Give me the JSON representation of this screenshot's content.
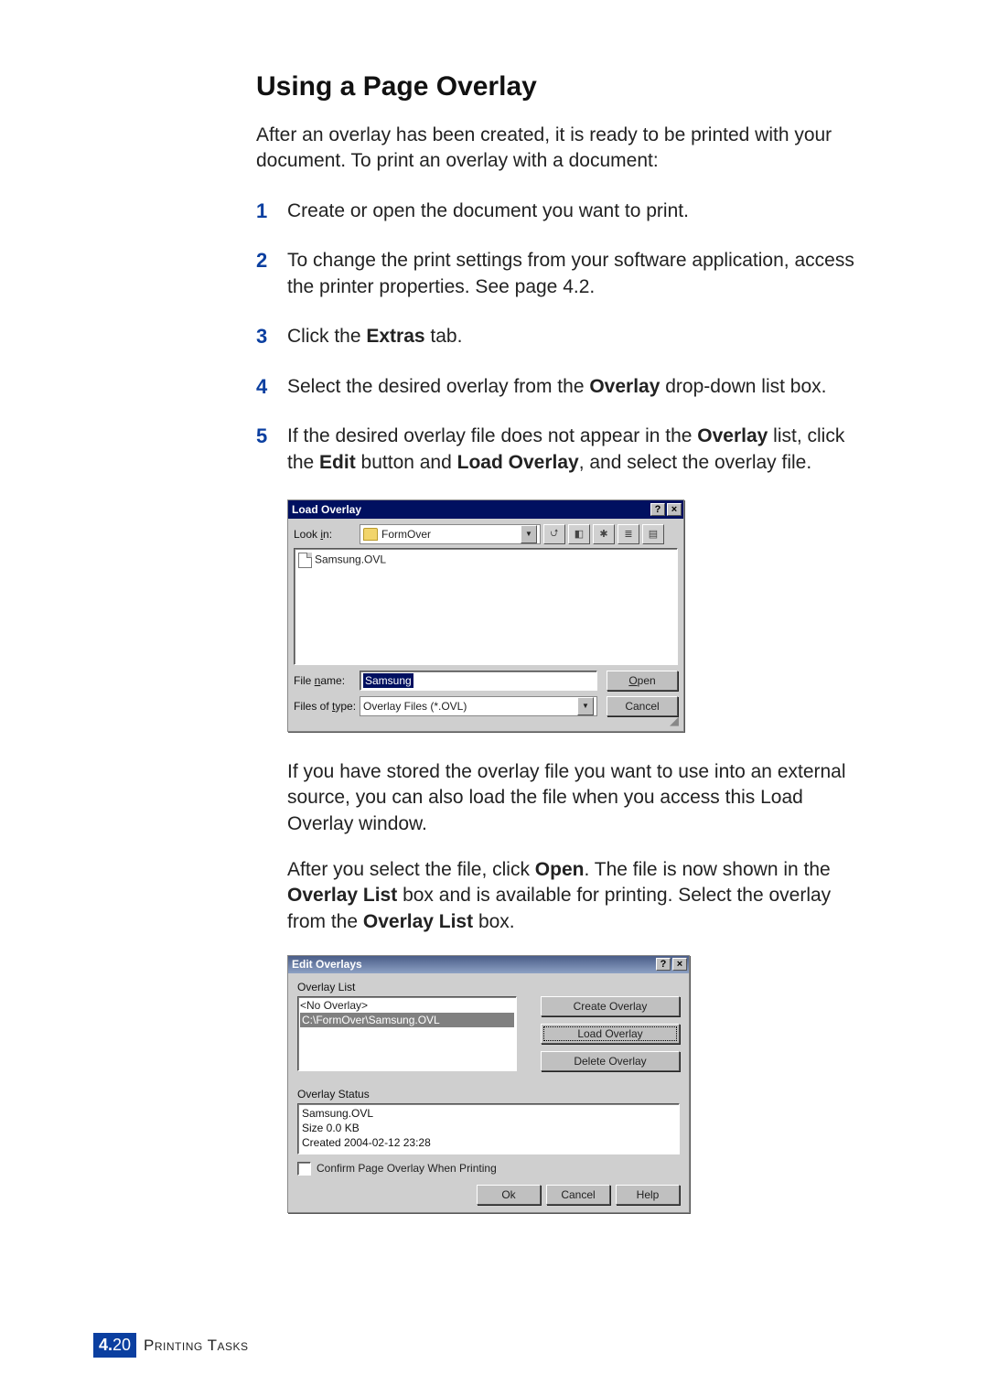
{
  "title": "Using a Page Overlay",
  "intro": "After an overlay has been created, it is ready to be printed with your document. To print an overlay with a document:",
  "steps": {
    "s1": {
      "num": "1",
      "text": "Create or open the document you want to print."
    },
    "s2": {
      "num": "2",
      "before": "To change the print settings from your software application, access the printer properties. See ",
      "link": "page 4.2",
      "after": "."
    },
    "s3": {
      "num": "3",
      "before": "Click the ",
      "bold": "Extras",
      "after": " tab."
    },
    "s4": {
      "num": "4",
      "before": "Select the desired overlay from the ",
      "bold": "Overlay",
      "after": " drop-down list box."
    },
    "s5": {
      "num": "5",
      "seg1": "If the desired overlay file does not appear in the ",
      "b1": "Overlay",
      "seg2": " list, click the ",
      "b2": "Edit",
      "seg3": " button and ",
      "b3": "Load Overlay",
      "seg4": ", and select the overlay file."
    }
  },
  "load_dialog": {
    "title": "Load Overlay",
    "help_btn": "?",
    "close_btn": "×",
    "look_in_lbl": {
      "pre": "Look ",
      "u": "i",
      "post": "n:"
    },
    "look_in_value": "FormOver",
    "icons": {
      "up": "folder-up-icon",
      "desktop": "desktop-icon",
      "newfolder": "new-folder-icon",
      "list": "list-view-icon",
      "details": "details-view-icon"
    },
    "file_item": "Samsung.OVL",
    "filename_lbl": {
      "pre": "File ",
      "u": "n",
      "post": "ame:"
    },
    "filename_value": "Samsung",
    "filetype_lbl": {
      "pre": "Files of ",
      "u": "t",
      "post": "ype:"
    },
    "filetype_value": "Overlay Files (*.OVL)",
    "open_btn": {
      "u": "O",
      "rest": "pen"
    },
    "cancel_btn": "Cancel"
  },
  "post_dialog_para": "If you have stored the overlay file you want to use into an external source, you can also load the file when you access this Load Overlay window.",
  "post_dialog_para2": {
    "seg1": "After you select the file, click ",
    "b1": "Open",
    "seg2": ". The file is now shown in the ",
    "b2": "Overlay List",
    "seg3": " box and is available for printing. Select the overlay from the ",
    "b3": "Overlay List",
    "seg4": " box."
  },
  "edit_dialog": {
    "title": "Edit Overlays",
    "help_btn": "?",
    "close_btn": "×",
    "list_label": "Overlay List",
    "list_item_none": "<No Overlay>",
    "list_item_sel": "C:\\FormOver\\Samsung.OVL",
    "btn_create": "Create Overlay",
    "btn_load": "Load Overlay",
    "btn_delete": "Delete Overlay",
    "status_label": "Overlay Status",
    "status_line1": "Samsung.OVL",
    "status_line2": "Size 0.0 KB",
    "status_line3": "Created 2004-02-12 23:28",
    "checkbox_label": "Confirm Page Overlay When Printing",
    "btn_ok": "Ok",
    "btn_cancel": "Cancel",
    "btn_help": "Help"
  },
  "footer": {
    "chapter": "4.",
    "page": "20",
    "section": "Printing Tasks"
  }
}
